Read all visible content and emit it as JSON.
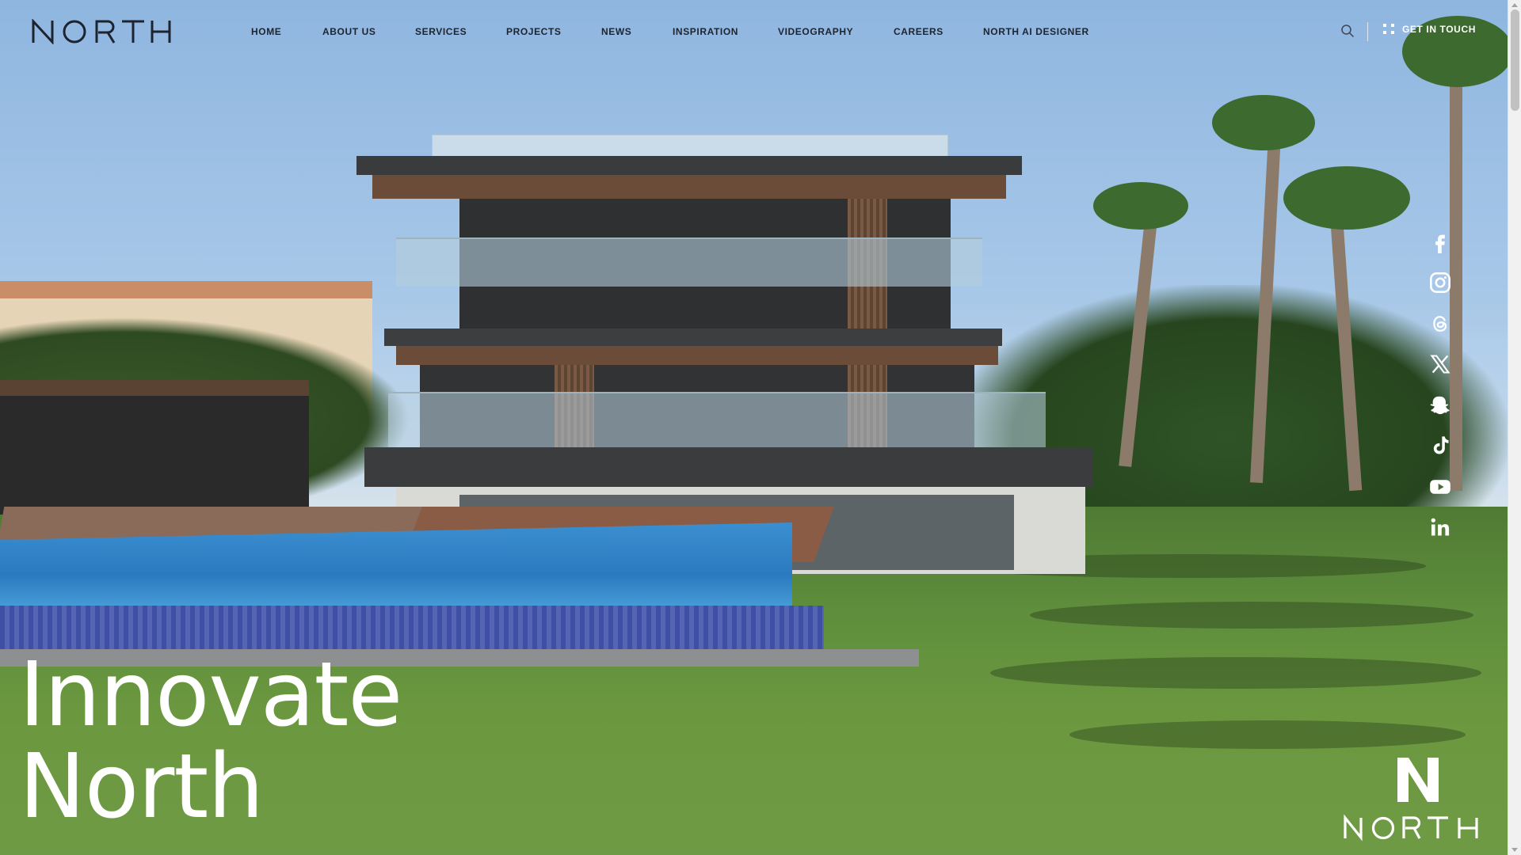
{
  "brand": {
    "name": "NORTH"
  },
  "nav": {
    "items": [
      {
        "label": "HOME"
      },
      {
        "label": "ABOUT US"
      },
      {
        "label": "SERVICES"
      },
      {
        "label": "PROJECTS"
      },
      {
        "label": "NEWS"
      },
      {
        "label": "INSPIRATION"
      },
      {
        "label": "VIDEOGRAPHY"
      },
      {
        "label": "CAREERS"
      },
      {
        "label": "NORTH AI DESIGNER"
      }
    ]
  },
  "header": {
    "cta_label": "GET IN TOUCH"
  },
  "social": {
    "icons": [
      "facebook-icon",
      "instagram-icon",
      "threads-icon",
      "x-icon",
      "snapchat-icon",
      "tiktok-icon",
      "youtube-icon",
      "linkedin-icon"
    ]
  },
  "hero": {
    "line1": "Innovate",
    "line2": "North"
  },
  "colors": {
    "nav_text": "#1d2430",
    "accent": "#ffffff"
  }
}
